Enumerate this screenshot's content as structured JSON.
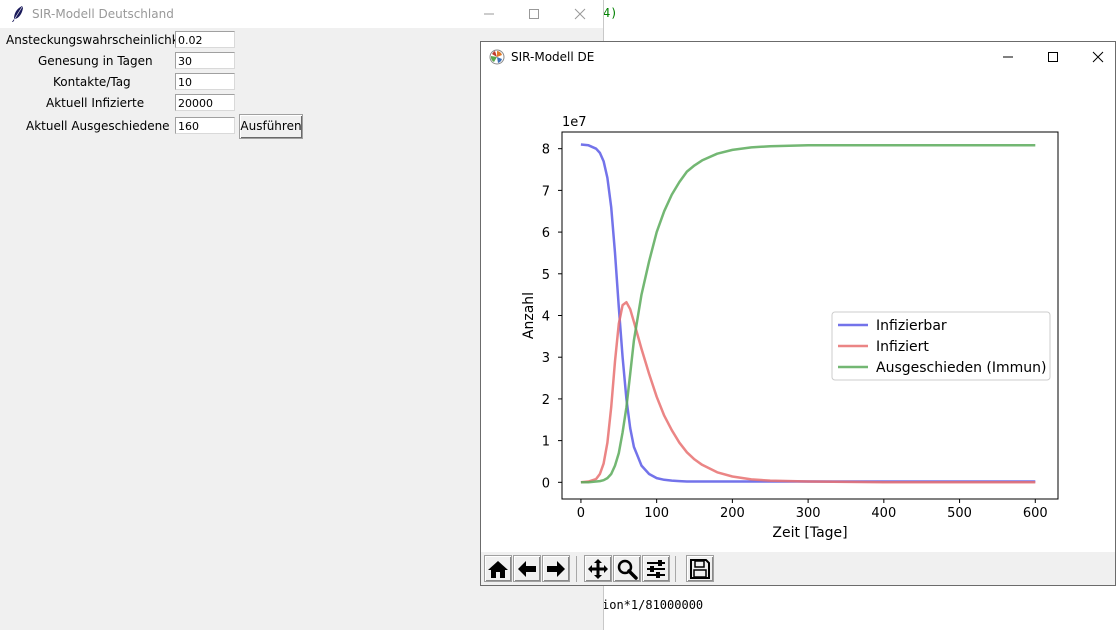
{
  "background": {
    "top_fragment": "4)",
    "bottom_fragment": "ion*1/81000000"
  },
  "tk_window": {
    "title": "SIR-Modell Deutschland",
    "fields": [
      {
        "label": "Ansteckungswahrscheinlichkeit",
        "value": "0.02"
      },
      {
        "label": "Genesung in Tagen",
        "value": "30"
      },
      {
        "label": "Kontakte/Tag",
        "value": "10"
      },
      {
        "label": "Aktuell Infizierte",
        "value": "20000"
      },
      {
        "label": "Aktuell Ausgeschiedene",
        "value": "160"
      }
    ],
    "run_button": "Ausführen"
  },
  "plot_window": {
    "title": "SIR-Modell DE",
    "toolbar": [
      "home-icon",
      "back-icon",
      "forward-icon",
      "pan-icon",
      "zoom-icon",
      "configure-subplots-icon",
      "save-icon"
    ]
  },
  "chart_data": {
    "type": "line",
    "title": "",
    "xlabel": "Zeit [Tage]",
    "ylabel": "Anzahl",
    "y_offset_label": "1e7",
    "xlim": [
      -25,
      630
    ],
    "ylim": [
      -0.4,
      8.4
    ],
    "xticks": [
      0,
      100,
      200,
      300,
      400,
      500,
      600
    ],
    "yticks": [
      0,
      1,
      2,
      3,
      4,
      5,
      6,
      7,
      8
    ],
    "legend_position": "center-right",
    "grid": false,
    "x": [
      0,
      10,
      20,
      25,
      30,
      35,
      40,
      45,
      50,
      55,
      60,
      65,
      70,
      80,
      90,
      100,
      110,
      120,
      130,
      140,
      150,
      160,
      180,
      200,
      225,
      250,
      300,
      350,
      400,
      500,
      600
    ],
    "series": [
      {
        "name": "Infizierbar",
        "color": "#5a5ae6",
        "values": [
          8.1,
          8.08,
          8.0,
          7.9,
          7.7,
          7.3,
          6.6,
          5.5,
          4.2,
          3.0,
          2.0,
          1.3,
          0.85,
          0.4,
          0.2,
          0.1,
          0.06,
          0.04,
          0.03,
          0.02,
          0.02,
          0.02,
          0.02,
          0.02,
          0.02,
          0.02,
          0.02,
          0.02,
          0.02,
          0.02,
          0.02
        ]
      },
      {
        "name": "Infiziert",
        "color": "#e87070",
        "values": [
          0.0,
          0.02,
          0.08,
          0.2,
          0.45,
          0.95,
          1.8,
          2.9,
          3.8,
          4.25,
          4.32,
          4.15,
          3.85,
          3.2,
          2.6,
          2.05,
          1.6,
          1.25,
          0.95,
          0.72,
          0.55,
          0.42,
          0.24,
          0.14,
          0.07,
          0.04,
          0.02,
          0.01,
          0.0,
          0.0,
          0.0
        ]
      },
      {
        "name": "Ausgeschieden (Immun)",
        "color": "#5aaa5a",
        "values": [
          0.0,
          0.0,
          0.02,
          0.03,
          0.05,
          0.1,
          0.2,
          0.4,
          0.7,
          1.2,
          1.8,
          2.6,
          3.4,
          4.5,
          5.3,
          6.0,
          6.5,
          6.9,
          7.2,
          7.45,
          7.6,
          7.72,
          7.88,
          7.97,
          8.03,
          8.06,
          8.08,
          8.08,
          8.08,
          8.08,
          8.08
        ]
      }
    ]
  }
}
